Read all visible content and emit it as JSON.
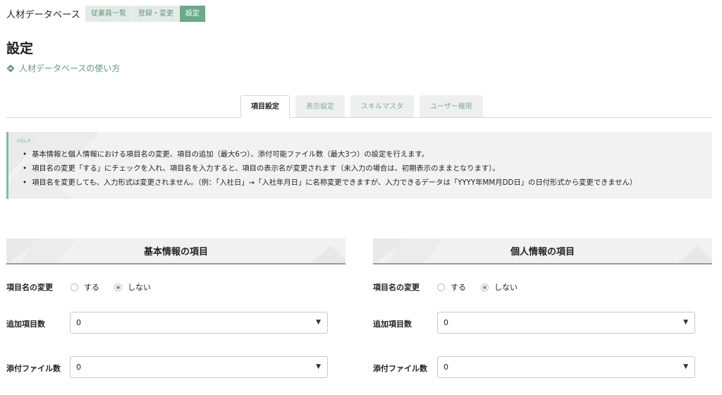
{
  "app_title": "人材データベース",
  "nav": {
    "items": [
      {
        "label": "従業員一覧"
      },
      {
        "label": "登録・変更"
      },
      {
        "label": "設定"
      }
    ]
  },
  "page_title": "設定",
  "help_link": {
    "label": "人材データベースの使い方",
    "icon": "diamond-arrow-icon"
  },
  "tabs": [
    {
      "label": "項目設定"
    },
    {
      "label": "表示設定"
    },
    {
      "label": "スキルマスタ"
    },
    {
      "label": "ユーザー権限"
    }
  ],
  "help": {
    "label": "HELP",
    "items": [
      "基本情報と個人情報における項目名の変更、項目の追加（最大6つ）、添付可能ファイル数（最大3つ）の設定を行えます。",
      "項目名の変更「する」にチェックを入れ、項目名を入力すると、項目の表示名が変更されます（未入力の場合は、初期表示のままとなります）。",
      "項目名を変更しても、入力形式は変更されません。（例：「入社日」→「入社年月日」に名称変更できますが、入力できるデータは「YYYY年MM月DD日」の日付形式から変更できません）"
    ]
  },
  "sections": {
    "basic": {
      "title": "基本情報の項目",
      "rename_label": "項目名の変更",
      "radio_yes": "する",
      "radio_no": "しない",
      "selected": "しない",
      "add_items_label": "追加項目数",
      "add_items_value": "0",
      "attach_label": "添付ファイル数",
      "attach_value": "0"
    },
    "personal": {
      "title": "個人情報の項目",
      "rename_label": "項目名の変更",
      "radio_yes": "する",
      "radio_no": "しない",
      "selected": "しない",
      "add_items_label": "追加項目数",
      "add_items_value": "0",
      "attach_label": "添付ファイル数",
      "attach_value": "0"
    }
  },
  "colors": {
    "accent": "#6aa98a",
    "accent_text": "#5f9a7c",
    "help_border": "#7fbf9c"
  }
}
